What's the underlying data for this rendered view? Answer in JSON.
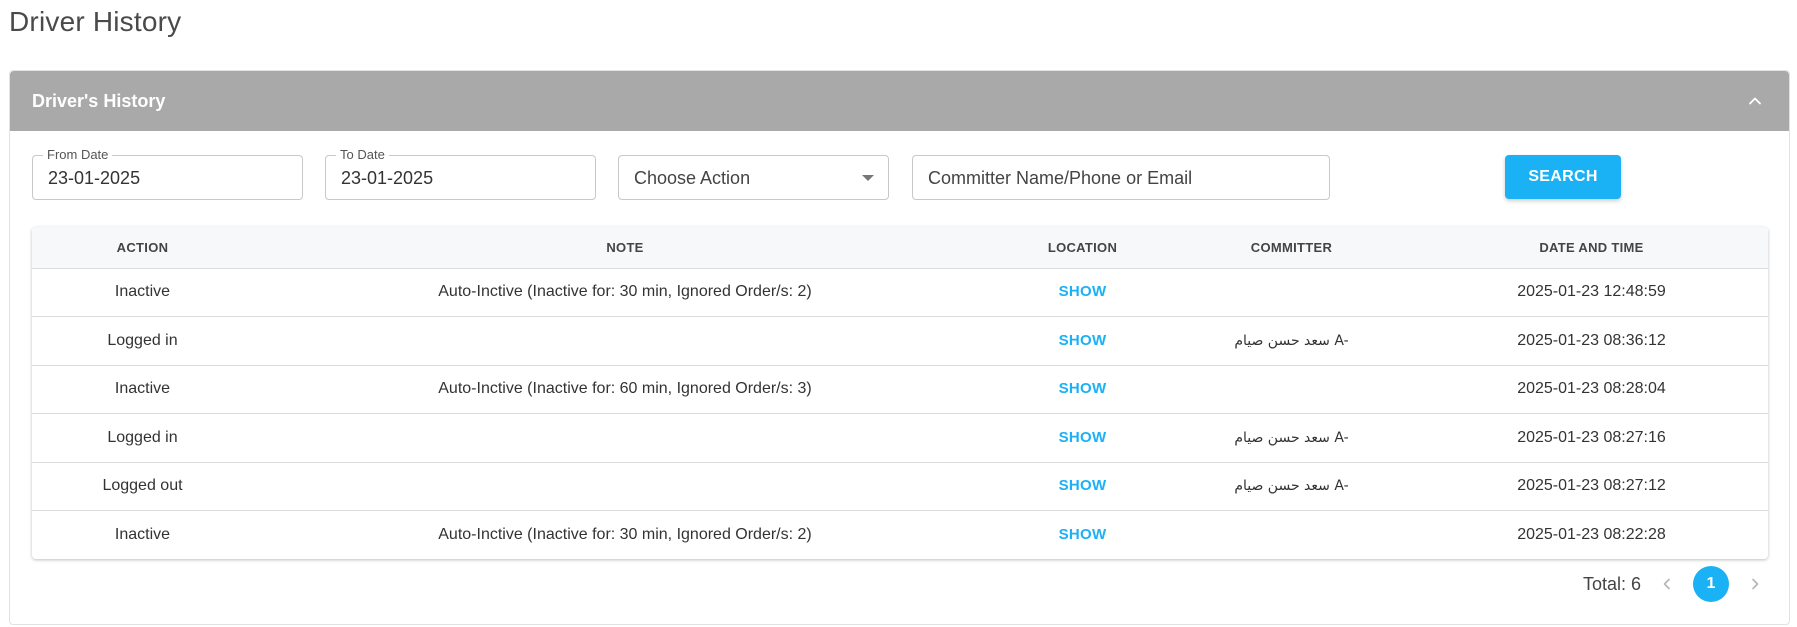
{
  "page": {
    "title": "Driver History"
  },
  "card": {
    "title": "Driver's History"
  },
  "filters": {
    "from_date": {
      "label": "From Date",
      "value": "23-01-2025"
    },
    "to_date": {
      "label": "To Date",
      "value": "23-01-2025"
    },
    "action_select": {
      "placeholder": "Choose Action"
    },
    "committer_input": {
      "placeholder": "Committer Name/Phone or Email"
    },
    "search_label": "SEARCH"
  },
  "table": {
    "columns": [
      "ACTION",
      "NOTE",
      "LOCATION",
      "COMMITTER",
      "DATE AND TIME"
    ],
    "rows": [
      {
        "action": "Inactive",
        "note": "Auto-Inctive (Inactive for: 30 min, Ignored Order/s: 2)",
        "location": "SHOW",
        "committer": "",
        "datetime": "2025-01-23 12:48:59"
      },
      {
        "action": "Logged in",
        "note": "",
        "location": "SHOW",
        "committer": "سعد حسن صيام A-",
        "datetime": "2025-01-23 08:36:12"
      },
      {
        "action": "Inactive",
        "note": "Auto-Inctive (Inactive for: 60 min, Ignored Order/s: 3)",
        "location": "SHOW",
        "committer": "",
        "datetime": "2025-01-23 08:28:04"
      },
      {
        "action": "Logged in",
        "note": "",
        "location": "SHOW",
        "committer": "سعد حسن صيام A-",
        "datetime": "2025-01-23 08:27:16"
      },
      {
        "action": "Logged out",
        "note": "",
        "location": "SHOW",
        "committer": "سعد حسن صيام A-",
        "datetime": "2025-01-23 08:27:12"
      },
      {
        "action": "Inactive",
        "note": "Auto-Inctive (Inactive for: 30 min, Ignored Order/s: 2)",
        "location": "SHOW",
        "committer": "",
        "datetime": "2025-01-23 08:22:28"
      }
    ]
  },
  "pagination": {
    "total_text": "Total: 6",
    "current_page": "1"
  },
  "colors": {
    "accent": "#1bb1f5",
    "header_bg": "#a9a9a9"
  },
  "icons": {
    "collapse": "chevron-up-icon",
    "dropdown": "caret-down-icon",
    "prev": "chevron-left-icon",
    "next": "chevron-right-icon"
  }
}
